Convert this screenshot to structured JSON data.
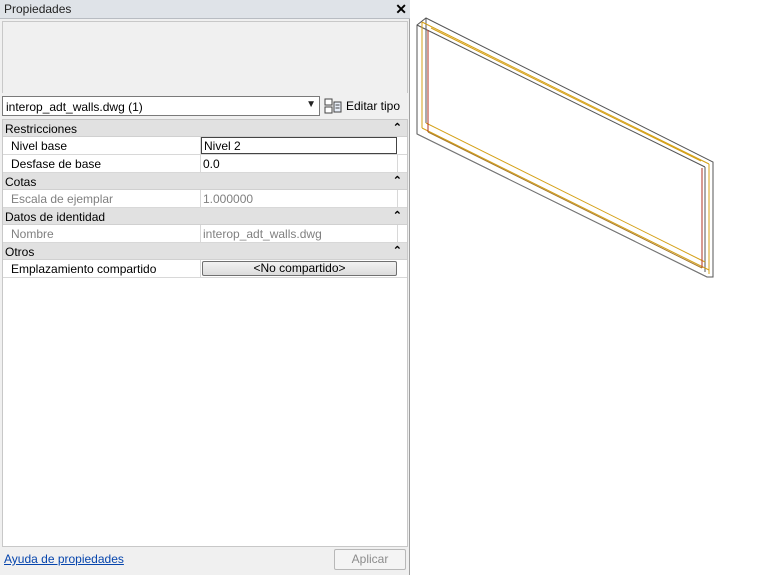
{
  "panel": {
    "title": "Propiedades",
    "type_selector": "interop_adt_walls.dwg (1)",
    "edit_type_label": "Editar tipo",
    "sections": [
      {
        "name": "Restricciones",
        "rows": [
          {
            "key": "Nivel base",
            "value": "Nivel 2"
          },
          {
            "key": "Desfase de base",
            "value": "0.0"
          }
        ]
      },
      {
        "name": "Cotas",
        "rows": [
          {
            "key": "Escala de ejemplar",
            "value": "1.000000"
          }
        ]
      },
      {
        "name": "Datos de identidad",
        "rows": [
          {
            "key": "Nombre",
            "value": "interop_adt_walls.dwg"
          }
        ]
      },
      {
        "name": "Otros",
        "rows": [
          {
            "key": "Emplazamiento compartido",
            "value": "<No compartido>"
          }
        ]
      }
    ],
    "help_link": "Ayuda de propiedades",
    "apply_button": "Aplicar"
  },
  "icons": {
    "close": "close-icon",
    "dropdown": "chevron-down-icon",
    "edit_type": "edit-type-icon",
    "collapse": "collapse-up-icon"
  },
  "colors": {
    "section_header": "#e1e1e1",
    "wall_outline": "#555555",
    "wall_highlight": "#d4a017",
    "wall_accent": "#b03020",
    "link": "#0645ad"
  }
}
